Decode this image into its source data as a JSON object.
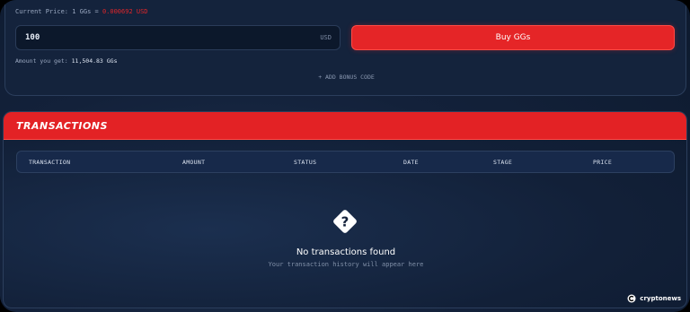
{
  "buy": {
    "price_label": "Current Price: 1 GGs = ",
    "price_value": "0.000692 USD",
    "amount_value": "100",
    "currency": "USD",
    "buy_button": "Buy GGs",
    "amount_get_label": "Amount you get: ",
    "amount_get_value": "11,504.83 GGs",
    "bonus_code": "+ ADD BONUS CODE"
  },
  "transactions": {
    "title": "TRANSACTIONS",
    "columns": [
      "TRANSACTION",
      "AMOUNT",
      "STATUS",
      "DATE",
      "STAGE",
      "PRICE"
    ],
    "empty_title": "No transactions found",
    "empty_subtitle": "Your transaction history will appear here"
  },
  "watermark": "cryptonews",
  "colors": {
    "accent": "#e52527",
    "panel": "#14233c",
    "background": "#0d1a2e"
  },
  "icons": {
    "empty": "question-diamond-icon",
    "watermark": "cryptonews-logo-icon"
  }
}
